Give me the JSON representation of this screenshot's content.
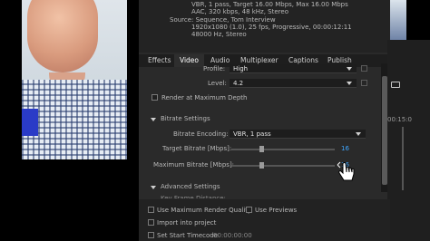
{
  "summary": {
    "lines": [
      "VBR, 1 pass, Target 16.00 Mbps, Max 16.00 Mbps",
      "AAC, 320 kbps, 48 kHz, Stereo",
      "Source: Sequence, Tom Interview",
      "1920x1080 (1.0), 25 fps, Progressive, 00:00:12:11",
      "48000 Hz, Stereo"
    ]
  },
  "tabs": [
    "Effects",
    "Video",
    "Audio",
    "Multiplexer",
    "Captions",
    "Publish"
  ],
  "video": {
    "profile_label": "Profile:",
    "profile_value": "High",
    "level_label": "Level:",
    "level_value": "4.2",
    "render_max_depth_label": "Render at Maximum Depth",
    "bitrate_section": "Bitrate Settings",
    "bitrate_encoding_label": "Bitrate Encoding:",
    "bitrate_encoding_value": "VBR, 1 pass",
    "target_bitrate_label": "Target Bitrate [Mbps]:",
    "target_bitrate_value": "16",
    "target_bitrate_level": 0.27,
    "max_bitrate_label": "Maximum Bitrate [Mbps]:",
    "max_bitrate_value": "16",
    "max_bitrate_level": 0.27,
    "advanced_section": "Advanced Settings",
    "key_frame_label": "Key Frame Distance:"
  },
  "bottom": {
    "use_max_render_quality": "Use Maximum Render Quality",
    "use_previews": "Use Previews",
    "import_into_project": "Import into project",
    "set_start_timecode": "Set Start Timecode",
    "timecode_value": "00:00:00:00"
  },
  "strip": {
    "timecode": "00:15:0"
  }
}
